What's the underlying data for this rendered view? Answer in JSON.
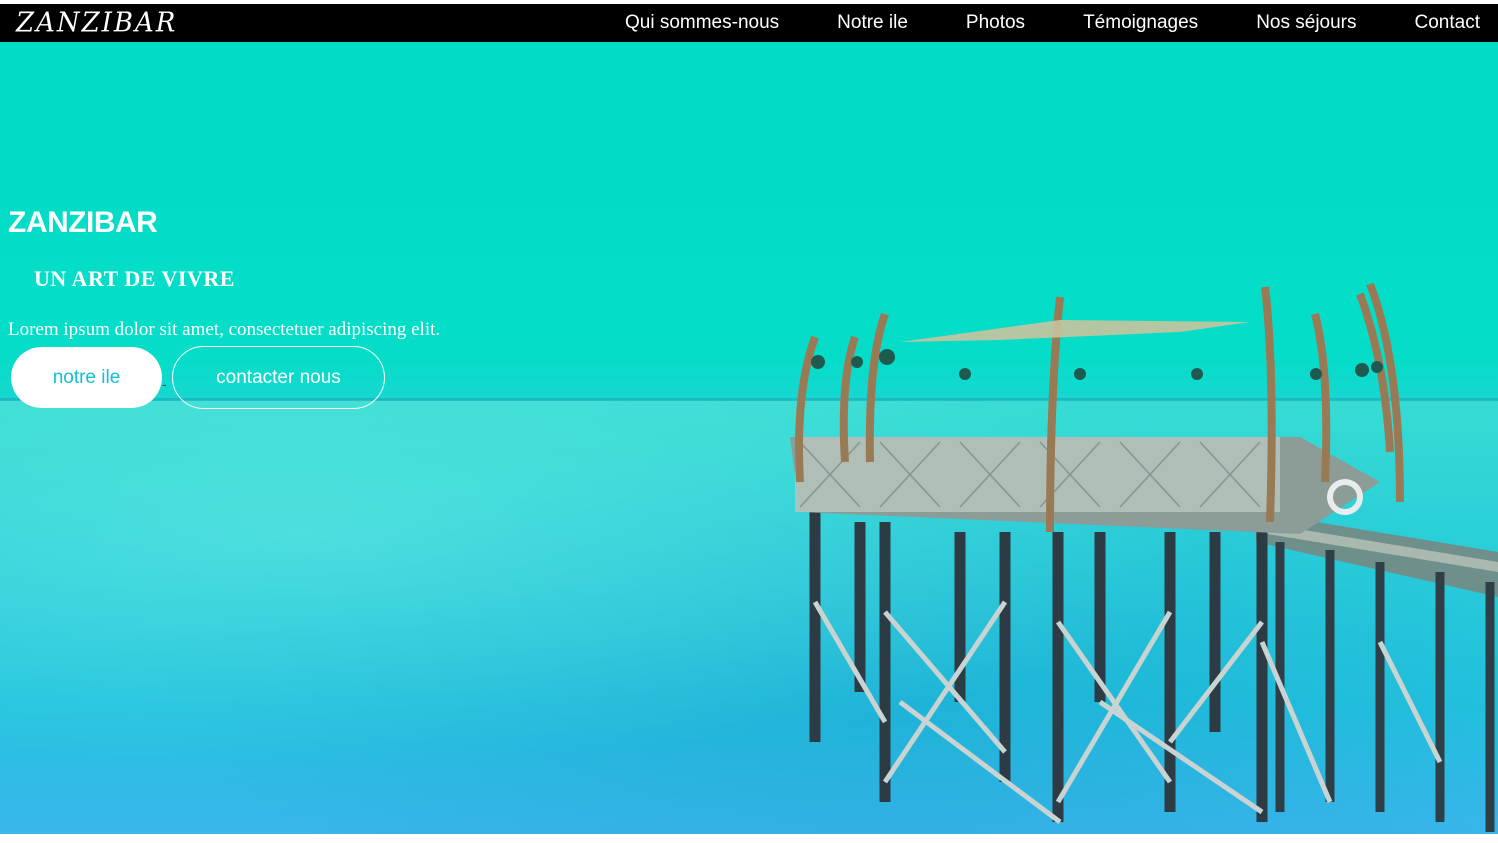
{
  "header": {
    "logo": "ZANZIBAR",
    "nav": [
      {
        "label": "Qui sommes-nous"
      },
      {
        "label": "Notre ile"
      },
      {
        "label": "Photos"
      },
      {
        "label": "Témoignages"
      },
      {
        "label": "Nos séjours"
      },
      {
        "label": "Contact"
      }
    ]
  },
  "hero": {
    "title": "ZANZIBAR",
    "subtitle": "UN ART DE VIVRE",
    "text": "Lorem ipsum dolor sit amet, consectetuer adipiscing elit.",
    "primary_button": "notre ile",
    "separator": "-",
    "secondary_button": "contacter nous",
    "image": "turquoise sea with wooden pier restaurant"
  },
  "colors": {
    "nav_background": "#000000",
    "hero_overlay": "#00dcc5",
    "button_text": "#12bfd6",
    "text": "#ffffff"
  }
}
